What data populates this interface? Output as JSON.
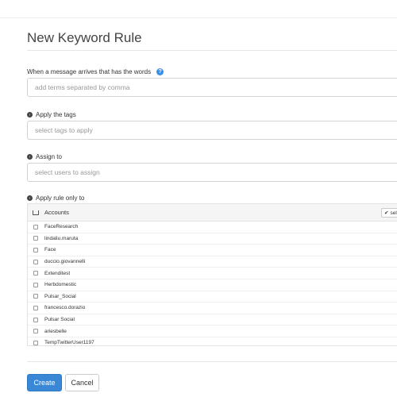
{
  "page": {
    "title": "New Keyword Rule"
  },
  "words": {
    "label": "When a message arrives that has the words",
    "placeholder": "add terms separated by comma"
  },
  "tags": {
    "label": "Apply the tags",
    "placeholder": "select tags to apply"
  },
  "assign": {
    "label": "Assign to",
    "placeholder": "select users to assign"
  },
  "apply_only": {
    "label": "Apply rule only to",
    "header": "Accounts",
    "select_button": "sel",
    "accounts": [
      "FaceResearch",
      "lindaliu.maruta",
      "Face",
      "duccio.giovannelli",
      "Extenditest",
      "Herbdomestic",
      "Pulsar_Social",
      "francesco.dorazio",
      "Pulsar Social",
      "ariesbelle",
      "TempTwitterUser1197"
    ]
  },
  "buttons": {
    "create": "Create",
    "cancel": "Cancel"
  },
  "colors": {
    "primary": "#3a87d6",
    "help": "#3a8ee6"
  }
}
